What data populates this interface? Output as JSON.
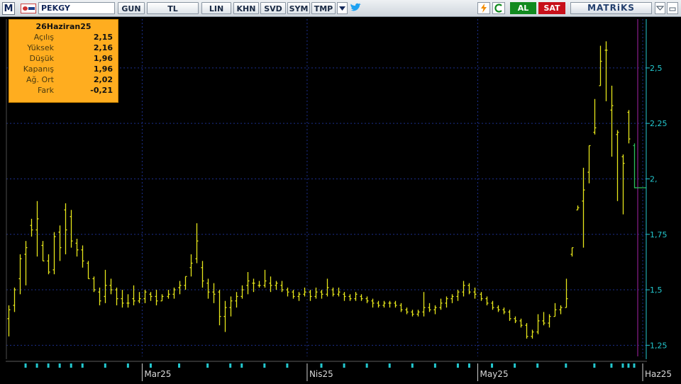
{
  "toolbar": {
    "logo": "M",
    "symbol": "PEKGY",
    "period": "GUN",
    "currency": "TL",
    "scale": "LIN",
    "buttons": [
      "KHN",
      "SVD",
      "SYM",
      "TMP"
    ],
    "al_label": "AL",
    "sat_label": "SAT",
    "brand": "MATRiKS",
    "icons": [
      "refresh-flash-icon",
      "c-icon",
      "dropdown-arrow-icon",
      "twitter-icon",
      "window-options-icon",
      "minimize-icon"
    ]
  },
  "info_box": {
    "date": "26Haziran25",
    "rows": [
      {
        "label": "Açılış",
        "value": "2,15"
      },
      {
        "label": "Yüksek",
        "value": "2,16"
      },
      {
        "label": "Düşük",
        "value": "1,96"
      },
      {
        "label": "Kapanış",
        "value": "1,96"
      },
      {
        "label": "Ağ. Ort",
        "value": "2,02"
      },
      {
        "label": "Fark",
        "value": "-0,21"
      }
    ]
  },
  "colors": {
    "background": "#000000",
    "bars": "#e6e61a",
    "grid": "#1c2f8c",
    "axis": "#23c8cf",
    "cursor": "#8a1d8c",
    "last_bar": "#2bbf5a",
    "info_bg": "#ffad1f"
  },
  "chart_data": {
    "type": "ohlc",
    "y_ticks": [
      "2,5",
      "2,25",
      "2,",
      "1,75",
      "1,5",
      "1,25"
    ],
    "y_tick_values": [
      2.5,
      2.25,
      2.0,
      1.75,
      1.5,
      1.25
    ],
    "ylim": [
      1.2,
      2.72
    ],
    "x_labels": [
      "Mar25",
      "Nis25",
      "May25",
      "Haz25"
    ],
    "x_label_index": [
      24,
      53,
      83,
      112
    ],
    "grid": true,
    "ohlc": [
      [
        1.37,
        1.43,
        1.29,
        1.41
      ],
      [
        1.43,
        1.51,
        1.4,
        1.5
      ],
      [
        1.55,
        1.66,
        1.48,
        1.64
      ],
      [
        1.66,
        1.72,
        1.52,
        1.69
      ],
      [
        1.79,
        1.82,
        1.74,
        1.77
      ],
      [
        1.77,
        1.9,
        1.65,
        1.82
      ],
      [
        1.7,
        1.72,
        1.63,
        1.63
      ],
      [
        1.63,
        1.66,
        1.57,
        1.58
      ],
      [
        1.59,
        1.76,
        1.57,
        1.74
      ],
      [
        1.76,
        1.79,
        1.63,
        1.69
      ],
      [
        1.86,
        1.89,
        1.66,
        1.77
      ],
      [
        1.83,
        1.86,
        1.69,
        1.72
      ],
      [
        1.71,
        1.73,
        1.65,
        1.68
      ],
      [
        1.68,
        1.7,
        1.6,
        1.63
      ],
      [
        1.62,
        1.63,
        1.55,
        1.55
      ],
      [
        1.55,
        1.56,
        1.49,
        1.5
      ],
      [
        1.49,
        1.51,
        1.43,
        1.45
      ],
      [
        1.47,
        1.59,
        1.44,
        1.52
      ],
      [
        1.52,
        1.55,
        1.48,
        1.5
      ],
      [
        1.5,
        1.51,
        1.43,
        1.46
      ],
      [
        1.46,
        1.5,
        1.42,
        1.44
      ],
      [
        1.44,
        1.48,
        1.42,
        1.44
      ],
      [
        1.46,
        1.52,
        1.43,
        1.45
      ],
      [
        1.45,
        1.49,
        1.44,
        1.46
      ],
      [
        1.46,
        1.5,
        1.44,
        1.49
      ],
      [
        1.48,
        1.49,
        1.45,
        1.47
      ],
      [
        1.47,
        1.5,
        1.43,
        1.45
      ],
      [
        1.45,
        1.48,
        1.45,
        1.47
      ],
      [
        1.47,
        1.5,
        1.46,
        1.48
      ],
      [
        1.48,
        1.51,
        1.46,
        1.5
      ],
      [
        1.51,
        1.54,
        1.48,
        1.52
      ],
      [
        1.52,
        1.56,
        1.5,
        1.56
      ],
      [
        1.6,
        1.66,
        1.56,
        1.62
      ],
      [
        1.64,
        1.8,
        1.62,
        1.72
      ],
      [
        1.6,
        1.63,
        1.51,
        1.54
      ],
      [
        1.53,
        1.55,
        1.46,
        1.49
      ],
      [
        1.49,
        1.53,
        1.44,
        1.48
      ],
      [
        1.49,
        1.5,
        1.34,
        1.38
      ],
      [
        1.38,
        1.45,
        1.31,
        1.42
      ],
      [
        1.42,
        1.47,
        1.38,
        1.45
      ],
      [
        1.45,
        1.49,
        1.42,
        1.47
      ],
      [
        1.47,
        1.52,
        1.46,
        1.5
      ],
      [
        1.52,
        1.58,
        1.48,
        1.54
      ],
      [
        1.53,
        1.55,
        1.49,
        1.53
      ],
      [
        1.52,
        1.54,
        1.51,
        1.52
      ],
      [
        1.52,
        1.59,
        1.51,
        1.54
      ],
      [
        1.53,
        1.56,
        1.49,
        1.52
      ],
      [
        1.52,
        1.54,
        1.5,
        1.53
      ],
      [
        1.52,
        1.54,
        1.49,
        1.5
      ],
      [
        1.5,
        1.51,
        1.47,
        1.49
      ],
      [
        1.49,
        1.5,
        1.46,
        1.47
      ],
      [
        1.47,
        1.49,
        1.45,
        1.48
      ],
      [
        1.48,
        1.51,
        1.47,
        1.49
      ],
      [
        1.49,
        1.5,
        1.45,
        1.47
      ],
      [
        1.47,
        1.51,
        1.46,
        1.49
      ],
      [
        1.49,
        1.5,
        1.46,
        1.48
      ],
      [
        1.48,
        1.55,
        1.47,
        1.51
      ],
      [
        1.5,
        1.51,
        1.47,
        1.48
      ],
      [
        1.48,
        1.51,
        1.47,
        1.49
      ],
      [
        1.48,
        1.49,
        1.45,
        1.47
      ],
      [
        1.47,
        1.48,
        1.45,
        1.46
      ],
      [
        1.46,
        1.49,
        1.45,
        1.48
      ],
      [
        1.47,
        1.48,
        1.45,
        1.46
      ],
      [
        1.46,
        1.47,
        1.44,
        1.45
      ],
      [
        1.45,
        1.46,
        1.42,
        1.44
      ],
      [
        1.44,
        1.45,
        1.42,
        1.43
      ],
      [
        1.43,
        1.45,
        1.42,
        1.44
      ],
      [
        1.44,
        1.45,
        1.42,
        1.44
      ],
      [
        1.44,
        1.45,
        1.42,
        1.43
      ],
      [
        1.43,
        1.44,
        1.4,
        1.41
      ],
      [
        1.41,
        1.42,
        1.39,
        1.4
      ],
      [
        1.4,
        1.41,
        1.38,
        1.39
      ],
      [
        1.39,
        1.41,
        1.38,
        1.4
      ],
      [
        1.4,
        1.49,
        1.38,
        1.42
      ],
      [
        1.42,
        1.44,
        1.4,
        1.41
      ],
      [
        1.41,
        1.43,
        1.39,
        1.42
      ],
      [
        1.42,
        1.46,
        1.41,
        1.44
      ],
      [
        1.44,
        1.47,
        1.42,
        1.46
      ],
      [
        1.46,
        1.48,
        1.44,
        1.47
      ],
      [
        1.47,
        1.5,
        1.45,
        1.49
      ],
      [
        1.49,
        1.54,
        1.47,
        1.52
      ],
      [
        1.52,
        1.53,
        1.48,
        1.49
      ],
      [
        1.49,
        1.51,
        1.46,
        1.48
      ],
      [
        1.48,
        1.49,
        1.45,
        1.46
      ],
      [
        1.46,
        1.47,
        1.43,
        1.44
      ],
      [
        1.44,
        1.45,
        1.41,
        1.42
      ],
      [
        1.42,
        1.43,
        1.4,
        1.41
      ],
      [
        1.41,
        1.42,
        1.39,
        1.4
      ],
      [
        1.4,
        1.41,
        1.36,
        1.37
      ],
      [
        1.37,
        1.38,
        1.35,
        1.36
      ],
      [
        1.36,
        1.37,
        1.33,
        1.34
      ],
      [
        1.34,
        1.35,
        1.28,
        1.29
      ],
      [
        1.29,
        1.32,
        1.28,
        1.31
      ],
      [
        1.31,
        1.39,
        1.3,
        1.36
      ],
      [
        1.36,
        1.4,
        1.34,
        1.35
      ],
      [
        1.35,
        1.39,
        1.33,
        1.38
      ],
      [
        1.38,
        1.44,
        1.38,
        1.41
      ],
      [
        1.41,
        1.43,
        1.39,
        1.42
      ],
      [
        1.42,
        1.55,
        1.42,
        1.46
      ],
      [
        1.66,
        1.69,
        1.65,
        1.69
      ],
      [
        1.86,
        1.88,
        1.86,
        1.87
      ],
      [
        1.9,
        2.05,
        1.69,
        1.95
      ],
      [
        2.03,
        2.15,
        1.98,
        2.15
      ],
      [
        2.21,
        2.36,
        2.2,
        2.23
      ],
      [
        2.42,
        2.6,
        2.42,
        2.53
      ],
      [
        2.58,
        2.62,
        2.35,
        2.58
      ],
      [
        2.31,
        2.42,
        2.1,
        2.33
      ],
      [
        2.2,
        2.22,
        1.9,
        2.21
      ],
      [
        2.1,
        2.11,
        1.84,
        2.07
      ],
      [
        2.3,
        2.31,
        2.16,
        2.18
      ],
      [
        2.15,
        2.16,
        1.96,
        1.96
      ]
    ]
  }
}
